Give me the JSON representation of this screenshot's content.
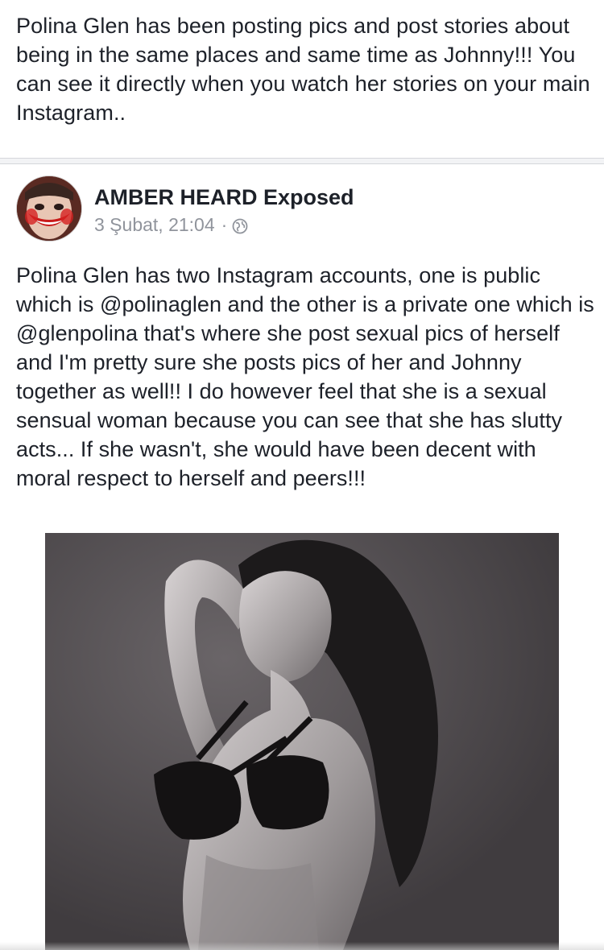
{
  "previous_post": {
    "text": "Polina Glen has been posting pics and post stories about being in the same places and same time as Johnny!!! You can see it directly when you watch her stories on your main Instagram.."
  },
  "post": {
    "author": "AMBER HEARD Exposed",
    "date": "3 Şubat, 21:04",
    "separator": "·",
    "privacy_icon": "globe-icon",
    "text": "Polina Glen has two Instagram accounts, one is public which is @polinaglen and the other is a private one which is @glenpolina that's where she post sexual pics of herself and I'm pretty sure she posts pics of her and Johnny together as well!! I do however feel that she is a sexual sensual woman because you can see that she has slutty acts... If she wasn't, she would have been decent with moral respect to herself and peers!!!"
  },
  "colors": {
    "text": "#1d2129",
    "meta": "#90949c",
    "divider": "#d5d7db",
    "photo_background": "#4a4649"
  }
}
